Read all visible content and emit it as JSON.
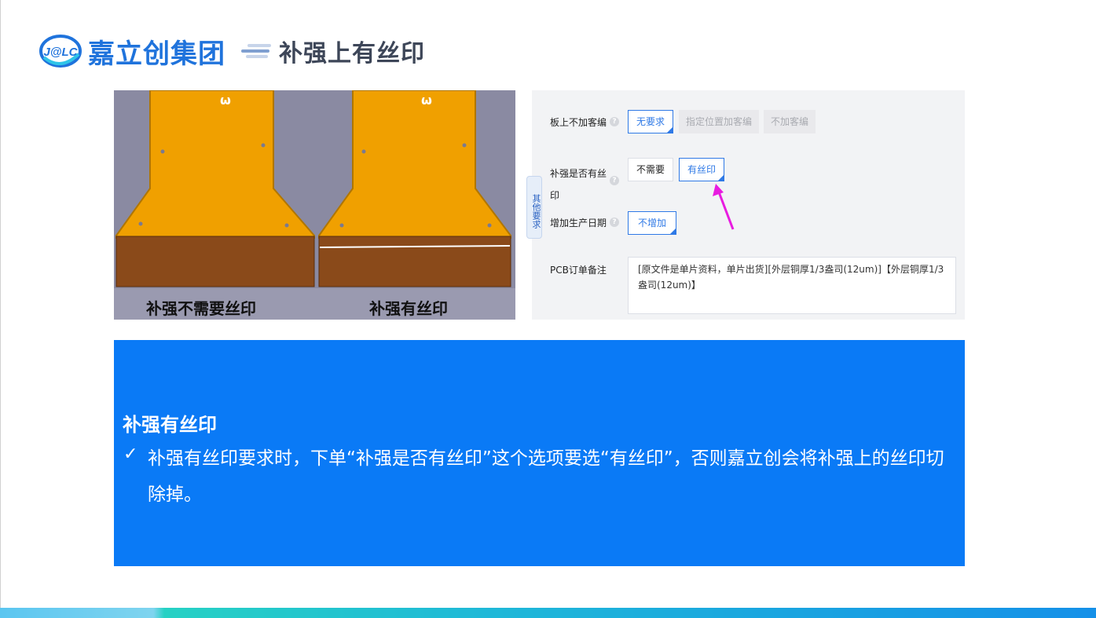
{
  "header": {
    "logo_mark": "J@LC",
    "logo_name": "嘉立创集团",
    "slide_title": "补强上有丝印"
  },
  "figure": {
    "label_left": "补强不需要丝印",
    "label_right": "补强有丝印"
  },
  "form": {
    "side_tab": "其他要求",
    "rows": [
      {
        "label": "板上不加客编",
        "options": [
          "无要求",
          "指定位置加客编",
          "不加客编"
        ],
        "selected": "无要求"
      },
      {
        "label": "补强是否有丝印",
        "options": [
          "不需要",
          "有丝印"
        ],
        "selected": "有丝印"
      },
      {
        "label": "增加生产日期",
        "options": [
          "不增加"
        ],
        "selected": "不增加"
      }
    ],
    "remark_label": "PCB订单备注",
    "remark_value": "[原文件是单片资料，单片出货][外层铜厚1/3盎司(12um)]【外层铜厚1/3盎司(12um)】",
    "help_glyph": "?"
  },
  "info": {
    "title": "补强有丝印",
    "check": "✓",
    "text": "补强有丝印要求时，下单“补强是否有丝印”这个选项要选“有丝印”，否则嘉立创会将补强上的丝印切除掉。"
  },
  "colors": {
    "brand_blue": "#1f73dc",
    "info_blue": "#0a7af6",
    "fpc_orange": "#f0a000",
    "stiffener_brown": "#8a4a1a",
    "arrow_magenta": "#e81ce0"
  }
}
